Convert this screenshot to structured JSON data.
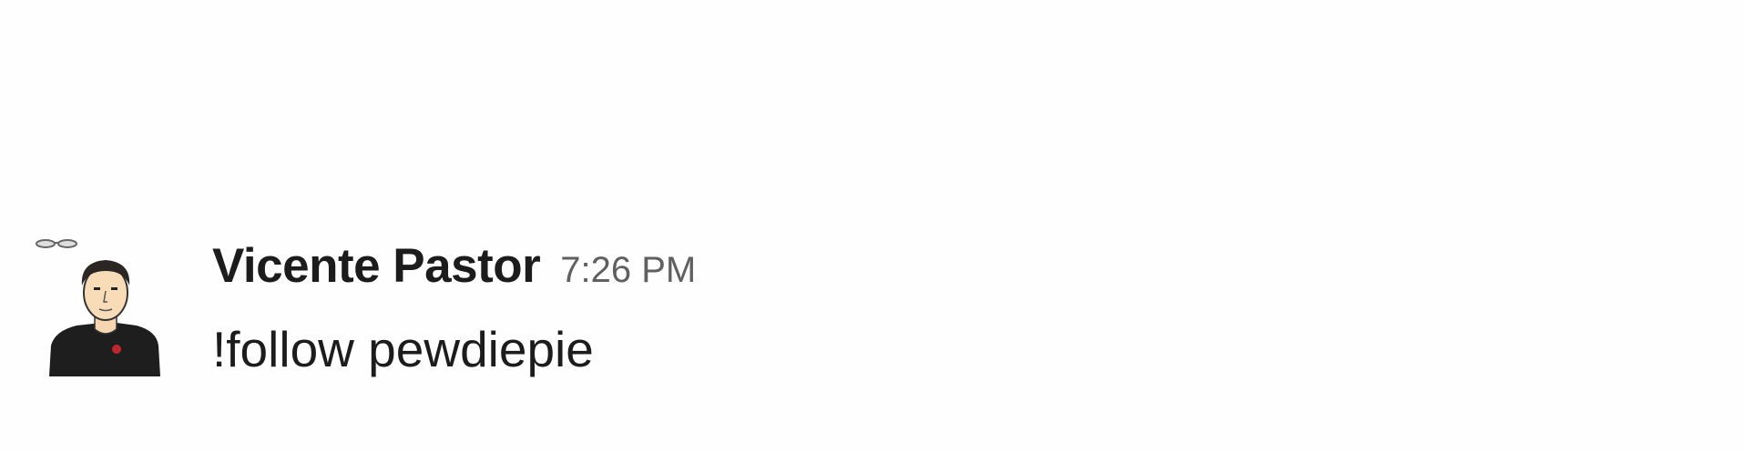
{
  "message": {
    "author": "Vicente Pastor",
    "timestamp": "7:26 PM",
    "text": "!follow pewdiepie",
    "avatar_icon": "user-avatar-icon"
  },
  "colors": {
    "background": "#fdfefd",
    "author_text": "#1d1c1d",
    "timestamp_text": "#616061",
    "message_text": "#1d1c1d"
  }
}
